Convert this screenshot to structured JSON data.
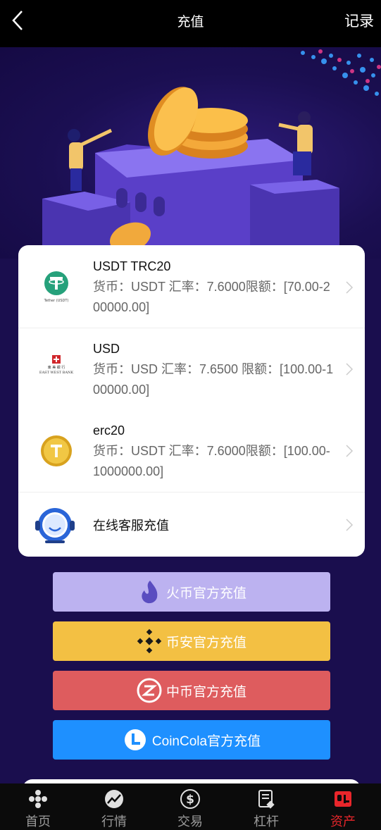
{
  "header": {
    "title": "充值",
    "action": "记录"
  },
  "methods": [
    {
      "title": "USDT TRC20",
      "desc": "货币：USDT 汇率：7.6000限额：[70.00-200000.00]",
      "icon": "tether-icon"
    },
    {
      "title": "USD",
      "desc": "货币：USD 汇率：7.6500 限额：[100.00-100000.00]",
      "icon": "east-west-bank-icon"
    },
    {
      "title": "erc20",
      "desc": "货币：USDT 汇率：7.6000限额：[100.00-1000000.00]",
      "icon": "gold-coin-icon"
    },
    {
      "title": "在线客服充值",
      "icon": "headset-icon"
    }
  ],
  "exchanges": [
    {
      "label": "火币官方充值",
      "color": "#bcb2f0",
      "icon": "huobi-flame-icon"
    },
    {
      "label": "币安官方充值",
      "color": "#f3c043",
      "icon": "binance-icon"
    },
    {
      "label": "中币官方充值",
      "color": "#de5c5e",
      "icon": "zb-icon"
    },
    {
      "label": "CoinCola官方充值",
      "color": "#1e90ff",
      "icon": "coincola-icon"
    }
  ],
  "tabs": [
    {
      "label": "首页",
      "icon": "home-icon"
    },
    {
      "label": "行情",
      "icon": "chart-icon"
    },
    {
      "label": "交易",
      "icon": "dollar-icon"
    },
    {
      "label": "杠杆",
      "icon": "document-icon"
    },
    {
      "label": "资产",
      "icon": "wallet-icon",
      "active": true
    }
  ],
  "colors": {
    "active_tab": "#e8262b",
    "background": "#1a0e4e"
  }
}
